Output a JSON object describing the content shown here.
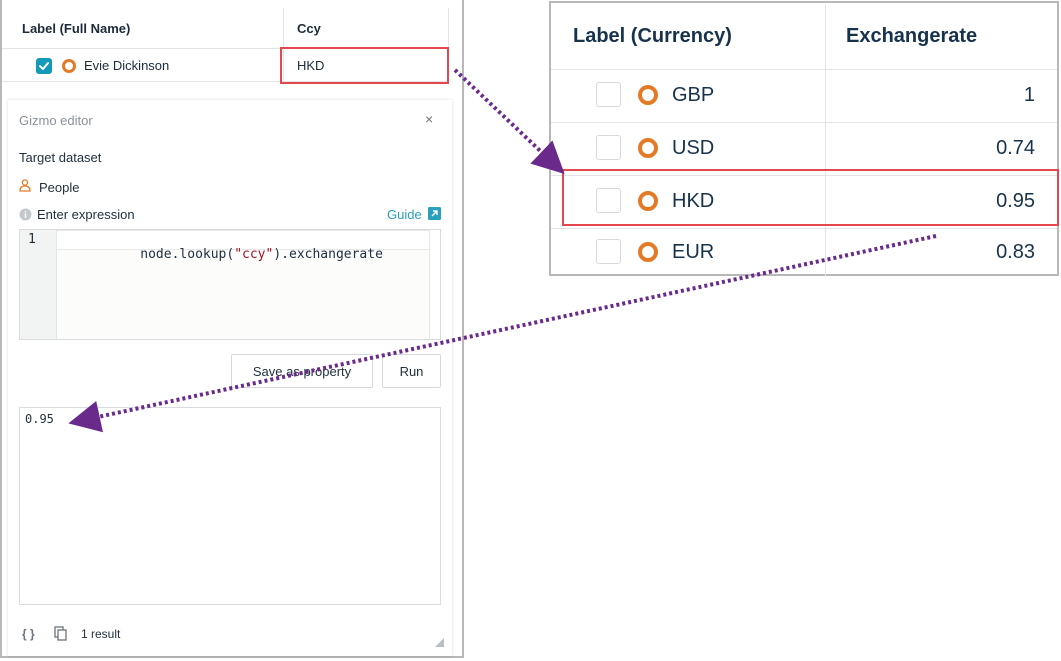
{
  "people_table": {
    "headers": [
      "Label (Full Name)",
      "Ccy"
    ],
    "row": {
      "name": "Evie Dickinson",
      "ccy": "HKD"
    }
  },
  "editor": {
    "title": "Gizmo editor",
    "close": "×",
    "target_dataset_label": "Target dataset",
    "dataset": "People",
    "expression_label": "Enter expression",
    "guide_label": "Guide",
    "line_number": "1",
    "code_parts": [
      "node.lookup(",
      "\"ccy\"",
      ").exchangerate"
    ],
    "save_button": "Save as property",
    "run_button": "Run",
    "result_value": "0.95",
    "result_count": "1 result"
  },
  "currency_table": {
    "headers": [
      "Label (Currency)",
      "Exchangerate"
    ],
    "rows": [
      {
        "label": "GBP",
        "rate": "1"
      },
      {
        "label": "USD",
        "rate": "0.74"
      },
      {
        "label": "HKD",
        "rate": "0.95"
      },
      {
        "label": "EUR",
        "rate": "0.83"
      }
    ]
  },
  "colors": {
    "accent": "#1499b8",
    "node_ring": "#e37b26",
    "highlight": "#e5474f",
    "arrow": "#6a2a8c",
    "guide_link": "#2aa0bf"
  }
}
